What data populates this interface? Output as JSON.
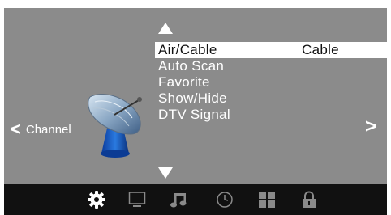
{
  "menu": {
    "items": [
      {
        "label": "Air/Cable",
        "value": "Cable",
        "selected": true
      },
      {
        "label": "Auto Scan",
        "value": ""
      },
      {
        "label": "Favorite",
        "value": ""
      },
      {
        "label": "Show/Hide",
        "value": ""
      },
      {
        "label": "DTV Signal",
        "value": ""
      }
    ]
  },
  "nav": {
    "left_label": "Channel",
    "left_chevron": "<",
    "right_chevron": ">"
  },
  "bottom_icons": [
    "gear-icon",
    "monitor-icon",
    "music-note-icon",
    "clock-icon",
    "grid-icon",
    "lock-icon"
  ],
  "active_icon": "gear-icon",
  "colors": {
    "panel": "#8b8b8b",
    "bar": "#111111",
    "highlight": "#ffffff",
    "text": "#ffffff"
  }
}
